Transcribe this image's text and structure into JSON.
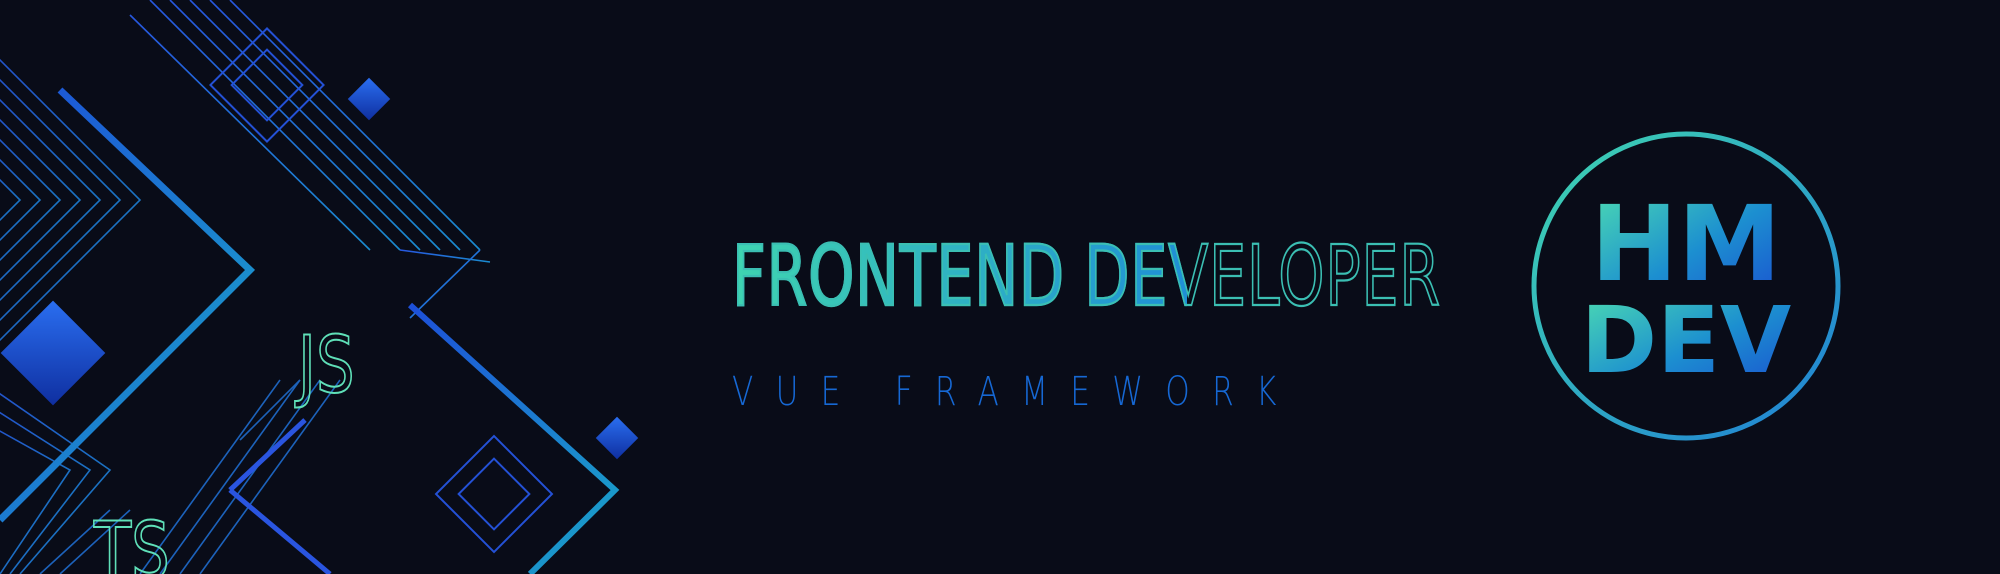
{
  "headline": "FRONTEND DEVELOPER",
  "subtitle": "VUE FRAMEWORK",
  "badges": {
    "js": "JS",
    "ts": "TS"
  },
  "logo": {
    "line1": "HM",
    "line2": "DEV"
  },
  "colors": {
    "background": "#090c18",
    "teal": "#3fd5b0",
    "blue": "#1f8fd6",
    "deep_blue": "#1668d4",
    "royal_blue": "#1d4fd8"
  }
}
